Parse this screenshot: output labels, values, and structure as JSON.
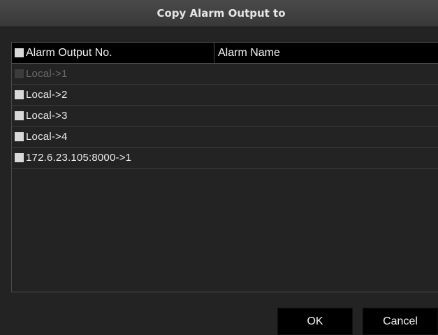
{
  "dialog": {
    "title": "Copy Alarm Output to"
  },
  "table": {
    "columns": [
      "Alarm Output No.",
      "Alarm Name"
    ],
    "header_checkbox_checked": false,
    "rows": [
      {
        "label": "Local->1",
        "alarm_name": "",
        "checked": false,
        "disabled": true
      },
      {
        "label": "Local->2",
        "alarm_name": "",
        "checked": false,
        "disabled": false
      },
      {
        "label": "Local->3",
        "alarm_name": "",
        "checked": false,
        "disabled": false
      },
      {
        "label": "Local->4",
        "alarm_name": "",
        "checked": false,
        "disabled": false
      },
      {
        "label": "172.6.23.105:8000->1",
        "alarm_name": "",
        "checked": false,
        "disabled": false
      }
    ]
  },
  "buttons": {
    "ok": "OK",
    "cancel": "Cancel"
  }
}
